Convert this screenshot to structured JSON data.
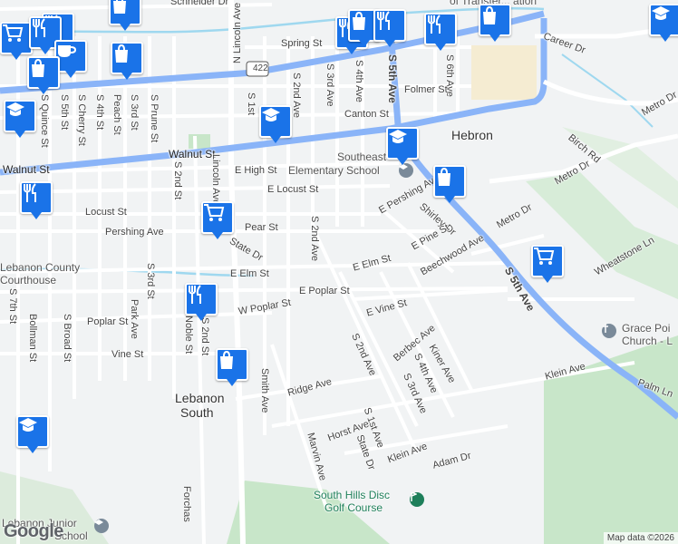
{
  "map": {
    "attribution": "Map data ©2026",
    "logo": "Google",
    "route_shield": "422",
    "colors": {
      "marker": "#1a73e8",
      "land": "#f1f3f4",
      "road": "#ffffff",
      "major_road": "#8ab4f8",
      "water": "#9fd8ef",
      "park": "#c8e6c9",
      "park_text": "#1e7f5a"
    },
    "places": {
      "hebron": "Hebron",
      "lebanon_south_1": "Lebanon",
      "lebanon_south_2": "South"
    },
    "pois": {
      "school_1": "Southeast",
      "school_2": "Elementary School",
      "courthouse_1": "Lebanon County",
      "courthouse_2": "Courthouse",
      "golf_1": "South Hills Disc",
      "golf_2": "Golf Course",
      "church_1": "Grace Poi",
      "church_2": "Church - L",
      "junior_1": "Lebanon Junior",
      "junior_2": "School",
      "transfer": "of Transfer... ation"
    },
    "streets": {
      "schneider": "Schneider Dr",
      "spring": "Spring St",
      "n_lincoln": "N Lincoln Ave",
      "s_1st_a": "S 1st",
      "s_2nd_ave_a": "S 2nd Ave",
      "s_3rd_ave_a": "S 3rd Ave",
      "s_4th_ave_a": "S 4th Ave",
      "s_5th_ave_a": "S 5th Ave",
      "s_6th_ave": "S 6th Ave",
      "folmer": "Folmer St",
      "canton": "Canton St",
      "walnut_1": "Walnut St",
      "walnut_2": "Walnut St",
      "high": "E High St",
      "locust_e": "E Locust St",
      "locust_w": "Locust St",
      "pear": "Pear St",
      "pershing_w": "Pershing Ave",
      "pershing_e": "E Pershing Ave",
      "shirley": "Shirley Dr",
      "e_pine": "E Pine St",
      "beechwood": "Beechwood Ave",
      "e_elm": "E Elm St",
      "e_elm_2": "E Elm St",
      "state_dr_a": "State Dr",
      "s_2nd_ave_b": "S 2nd Ave",
      "e_poplar": "E Poplar St",
      "w_poplar": "W Poplar St",
      "poplar": "Poplar St",
      "e_vine": "E Vine St",
      "vine": "Vine St",
      "kiner": "Kiner Ave",
      "s_2nd_ave_c": "S 2nd Ave",
      "berbec": "Berbec Ave",
      "s_4th_ave_b": "S 4th Ave",
      "s_3rd_ave_b": "S 3rd Ave",
      "ridge": "Ridge Ave",
      "horst": "Horst Ave",
      "s_1st_b": "S 1st Ave",
      "state_dr_b": "State Dr",
      "klein_1": "Klein Ave",
      "klein_2": "Klein Ave",
      "adam": "Adam Dr",
      "marvin": "Marvin Ave",
      "smith": "Smith Ave",
      "noble": "Noble St",
      "s_2nd_st_a": "S 2nd St",
      "s_2nd_st_b": "S 2nd St",
      "s_3rd_st_a": "S 3rd St",
      "s_3rd_st_b": "S 3rd St",
      "s_prune": "S Prune St",
      "peach": "Peach St",
      "s_4th": "S 4th St",
      "s_cherry": "S Cherry St",
      "s_5th": "S 5th St",
      "s_quince": "S Quince St",
      "s_7th": "S 7th St",
      "park_ave": "Park Ave",
      "s_broad": "S Broad St",
      "bollman": "Bollman St",
      "lincoln_ave": "Lincoln Ave",
      "elm_st_b": "Elm St",
      "s_5th_ave_b": "S 5th Ave",
      "career": "Career Dr",
      "metro_1": "Metro Dr",
      "metro_2": "Metro Dr",
      "metro_3": "Metro Dr",
      "birch": "Birch Rd",
      "wheatstone": "Wheatstone Ln",
      "palm": "Palm Ln",
      "forchas": "Forchas"
    },
    "markers": [
      {
        "icon": "dining-icon"
      },
      {
        "icon": "shopping-bag-icon"
      },
      {
        "icon": "dining-icon"
      },
      {
        "icon": "shopping-bag-icon"
      },
      {
        "icon": "dining-icon"
      },
      {
        "icon": "dining-icon"
      },
      {
        "icon": "shopping-bag-icon"
      },
      {
        "icon": "school-icon"
      },
      {
        "icon": "shopping-cart-icon"
      },
      {
        "icon": "dining-icon"
      },
      {
        "icon": "shopping-bag-icon"
      },
      {
        "icon": "cafe-icon"
      },
      {
        "icon": "shopping-bag-icon"
      },
      {
        "icon": "school-icon"
      },
      {
        "icon": "school-icon"
      },
      {
        "icon": "school-icon"
      },
      {
        "icon": "shopping-bag-icon"
      },
      {
        "icon": "dining-icon"
      },
      {
        "icon": "shopping-cart-icon"
      },
      {
        "icon": "shopping-cart-icon"
      },
      {
        "icon": "dining-icon"
      },
      {
        "icon": "shopping-bag-icon"
      },
      {
        "icon": "school-icon"
      }
    ]
  }
}
